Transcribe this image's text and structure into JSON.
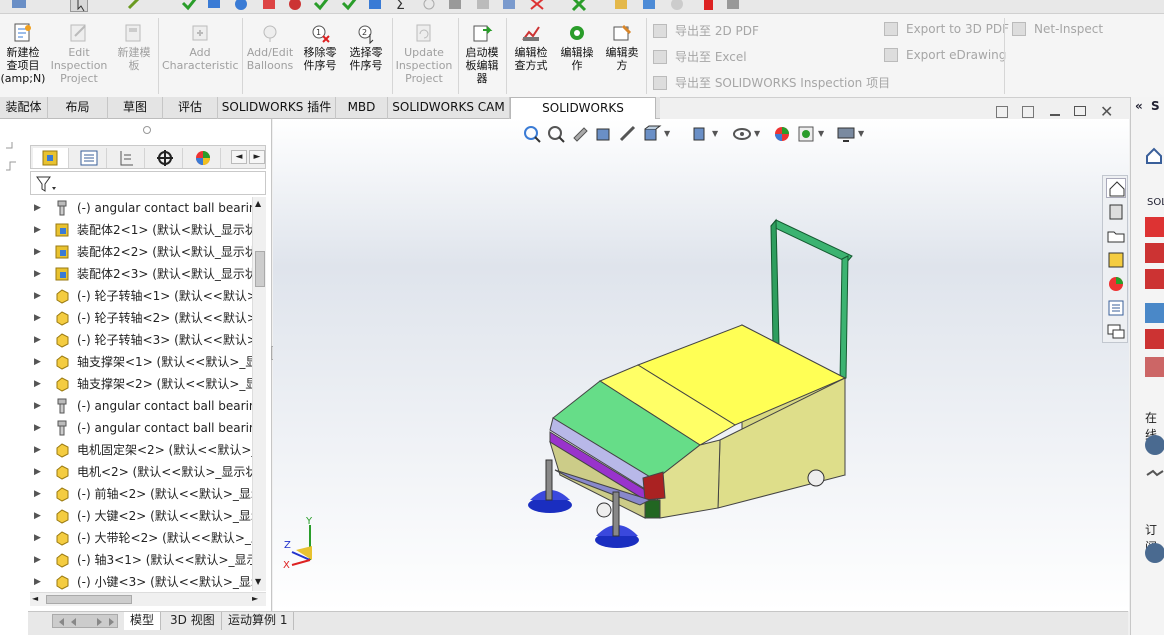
{
  "ribbon": {
    "new_project": "新建检\n查项目\n(amp;N)",
    "edit_project": "Edit\nInspection\nProject",
    "new_template": "新建模\n板",
    "add_characteristic": "Add\nCharacteristic",
    "add_edit_balloons": "Add/Edit\nBalloons",
    "remove_part_number": "移除零\n件序号",
    "select_part_number": "选择零\n件序号",
    "update_project": "Update\nInspection\nProject",
    "launch_template_editor": "启动模\n板编辑\n器",
    "edit_inspection_method": "编辑检\n查方式",
    "edit_operation": "编辑操\n作",
    "edit_vendor": "编辑卖\n方",
    "export_2d_pdf": "导出至 2D PDF",
    "export_excel": "导出至 Excel",
    "export_sw_inspection": "导出至 SOLIDWORKS Inspection 项目",
    "export_3d_pdf": "Export to 3D PDF",
    "export_edrawing": "Export eDrawing",
    "net_inspect": "Net-Inspect"
  },
  "tabs": [
    "装配体",
    "布局",
    "草图",
    "评估",
    "SOLIDWORKS 插件",
    "MBD",
    "SOLIDWORKS CAM",
    "SOLIDWORKS Inspection"
  ],
  "active_tab": "SOLIDWORKS Inspection",
  "tree": [
    {
      "icon": "bearing-icon",
      "label": "(-) angular contact ball bearing"
    },
    {
      "icon": "assembly-icon",
      "label": "装配体2<1> (默认<默认_显示状"
    },
    {
      "icon": "assembly-icon",
      "label": "装配体2<2> (默认<默认_显示状"
    },
    {
      "icon": "assembly-icon",
      "label": "装配体2<3> (默认<默认_显示状"
    },
    {
      "icon": "part-icon",
      "label": "(-) 轮子转轴<1> (默认<<默认>_"
    },
    {
      "icon": "part-icon",
      "label": "(-) 轮子转轴<2> (默认<<默认>_"
    },
    {
      "icon": "part-icon",
      "label": "(-) 轮子转轴<3> (默认<<默认>_"
    },
    {
      "icon": "part-icon",
      "label": "轴支撑架<1> (默认<<默认>_显"
    },
    {
      "icon": "part-icon",
      "label": "轴支撑架<2> (默认<<默认>_显"
    },
    {
      "icon": "bearing-icon",
      "label": "(-) angular contact ball bearing"
    },
    {
      "icon": "bearing-icon",
      "label": "(-) angular contact ball bearing"
    },
    {
      "icon": "part-icon",
      "label": "电机固定架<2> (默认<<默认>_"
    },
    {
      "icon": "part-icon",
      "label": "电机<2> (默认<<默认>_显示状"
    },
    {
      "icon": "part-icon",
      "label": "(-) 前轴<2> (默认<<默认>_显示"
    },
    {
      "icon": "part-icon",
      "label": "(-) 大键<2> (默认<<默认>_显示"
    },
    {
      "icon": "part-icon",
      "label": "(-) 大带轮<2> (默认<<默认>_显"
    },
    {
      "icon": "part-icon",
      "label": "(-) 轴3<1> (默认<<默认>_显示"
    },
    {
      "icon": "part-icon",
      "label": "(-) 小键<3> (默认<<默认>_显示"
    }
  ],
  "bottom_tabs": [
    "模型",
    "3D 视图",
    "运动算例 1"
  ],
  "active_bottom_tab": "模型",
  "taskpane": {
    "item1": "SOL",
    "item2": "在线",
    "item3": "订阅"
  },
  "triad": {
    "y": "Y",
    "z": "Z",
    "x": "X"
  },
  "colors": {
    "accent": "#1f6fc5",
    "handle": "#3cb371",
    "body_top": "#ffff55",
    "body_side": "#ffff88",
    "green_panel": "#66dd88",
    "brush": "#2233cc"
  }
}
